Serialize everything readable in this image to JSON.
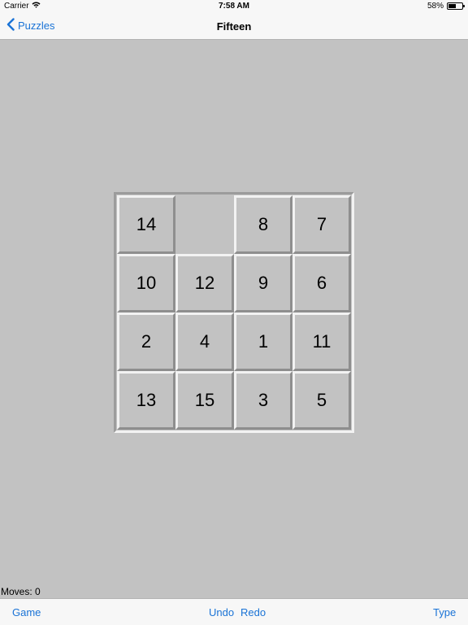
{
  "status_bar": {
    "carrier": "Carrier",
    "time": "7:58 AM",
    "battery_text": "58%",
    "battery_level": 0.58
  },
  "nav": {
    "back_label": "Puzzles",
    "title": "Fifteen"
  },
  "board": {
    "rows": 4,
    "cols": 4,
    "tiles": [
      "14",
      "",
      "8",
      "7",
      "10",
      "12",
      "9",
      "6",
      "2",
      "4",
      "1",
      "11",
      "13",
      "15",
      "3",
      "5"
    ]
  },
  "status": {
    "moves": "Moves: 0"
  },
  "toolbar": {
    "game": "Game",
    "undo": "Undo",
    "redo": "Redo",
    "type": "Type"
  },
  "colors": {
    "accent": "#1a73d6",
    "board_background": "#c2c2c2",
    "bar_background": "#f7f7f7"
  }
}
